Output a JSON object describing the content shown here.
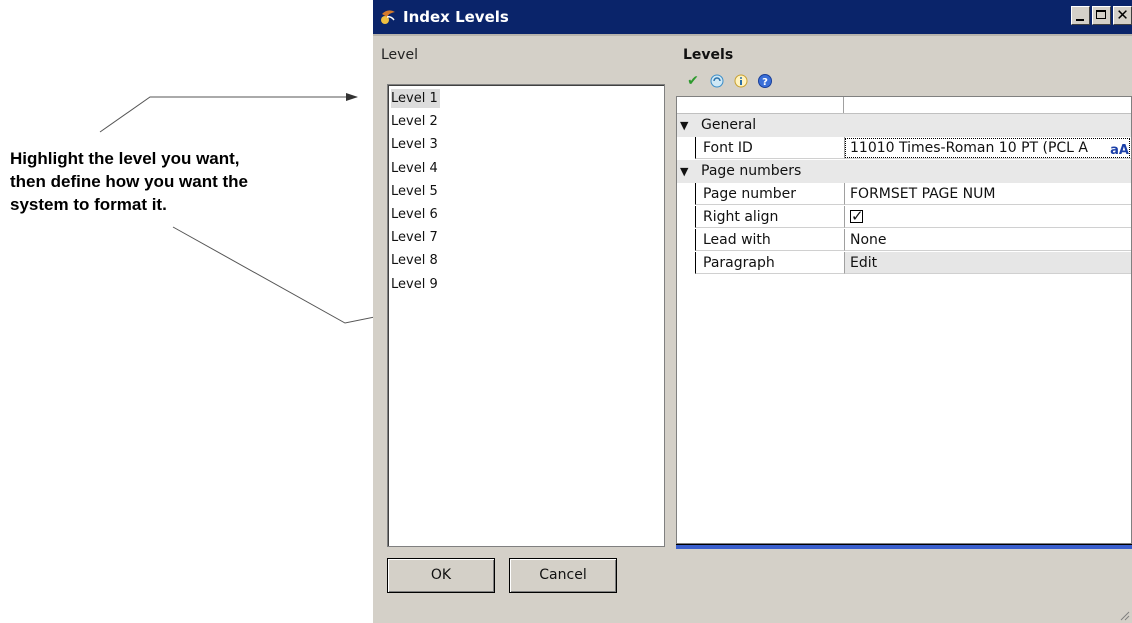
{
  "annotation": {
    "lines": [
      "Highlight the level you want,",
      "then define how you want the",
      "system to format it."
    ]
  },
  "window": {
    "title": "Index Levels",
    "controls": {
      "close": "✕"
    }
  },
  "left_panel": {
    "label": "Level",
    "items": [
      "Level 1",
      "Level 2",
      "Level 3",
      "Level 4",
      "Level 5",
      "Level 6",
      "Level 7",
      "Level 8",
      "Level 9"
    ],
    "selected": "Level 1"
  },
  "buttons": {
    "ok": "OK",
    "cancel": "Cancel"
  },
  "right_panel": {
    "title": "Levels",
    "toolbar": [
      "check-icon",
      "refresh-icon",
      "info-icon",
      "help-icon"
    ],
    "categories": {
      "general": "General",
      "page_numbers": "Page numbers"
    },
    "properties": {
      "font_id": {
        "name": "Font ID",
        "value": "11010 Times-Roman 10 PT (PCL A",
        "button": "aA"
      },
      "page_number": {
        "name": "Page number",
        "value": "FORMSET PAGE NUM"
      },
      "right_align": {
        "name": "Right align",
        "checked": true
      },
      "lead_with": {
        "name": "Lead with",
        "value": "None"
      },
      "paragraph": {
        "name": "Paragraph",
        "value": "Edit"
      }
    }
  },
  "colors": {
    "titlebar": "#0a246a",
    "window_bg": "#d4d0c8",
    "accent": "#3a5fcd"
  }
}
